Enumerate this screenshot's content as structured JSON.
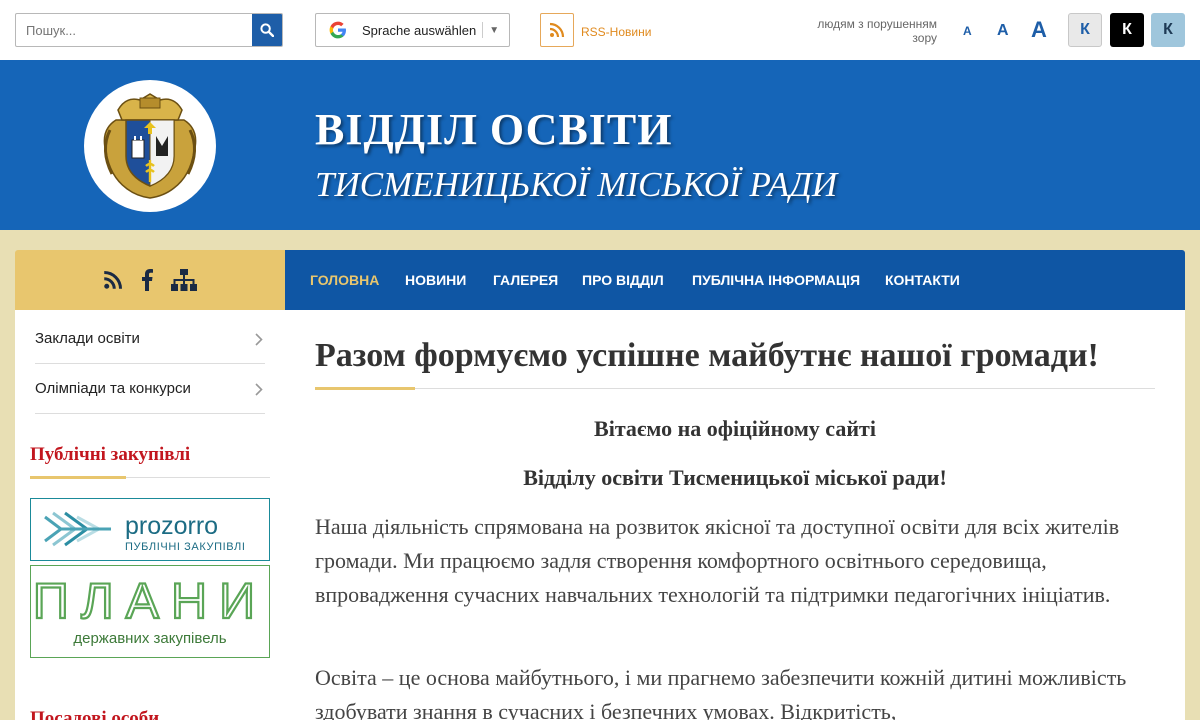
{
  "topbar": {
    "search_placeholder": "Пошук...",
    "translate_label": "Sprache auswählen",
    "translate_arrow": "▼",
    "rss_label": "RSS-Новини",
    "vision_label": "людям з порушенням зору",
    "font_sizes": [
      "A",
      "A",
      "A"
    ],
    "contrast_buttons": [
      "К",
      "К",
      "К"
    ]
  },
  "header": {
    "title": "ВІДДІЛ ОСВІТИ",
    "subtitle": "ТИСМЕНИЦЬКОЇ МІСЬКОЇ РАДИ"
  },
  "nav": {
    "items": [
      "Головна",
      "Новини",
      "Галерея",
      "Про відділ",
      "Публічна інформація",
      "Контакти"
    ],
    "active": "Головна"
  },
  "sidebar": {
    "icons": [
      "rss-icon",
      "facebook-icon",
      "sitemap-icon"
    ],
    "items": [
      "Заклади освіти",
      "Олімпіади та конкурси"
    ],
    "section_title": "Публічні закупівлі",
    "prozorro_name": "prozorro",
    "prozorro_sub": "ПУБЛІЧНІ ЗАКУПІВЛІ",
    "plany_name": "ПЛАНИ",
    "plany_sub": "державних закупівель",
    "section2_title": "Посадові особи"
  },
  "content": {
    "title": "Разом формуємо успішне майбутнє нашої громади!",
    "greeting1": "Вітаємо на офіційному сайті",
    "greeting2": "Відділу освіти Тисменицької міської ради!",
    "paragraph1": "Наша діяльність спрямована на розвиток якісної та доступної освіти для всіх жителів громади. Ми працюємо задля створення комфортного освітнього середовища, впровадження сучасних навчальних технологій та підтримки педагогічних ініціатив.",
    "paragraph2": "Освіта – це основа майбутнього, і ми прагнемо забезпечити кожній дитині можливість здобувати знання в сучасних і безпечних умовах. Відкритість,"
  },
  "colors": {
    "header_blue": "#1565b8",
    "nav_blue": "#0f56a4",
    "accent_gold": "#e8c66e",
    "section_red": "#c2161e",
    "page_bg": "#e8dfb4"
  }
}
